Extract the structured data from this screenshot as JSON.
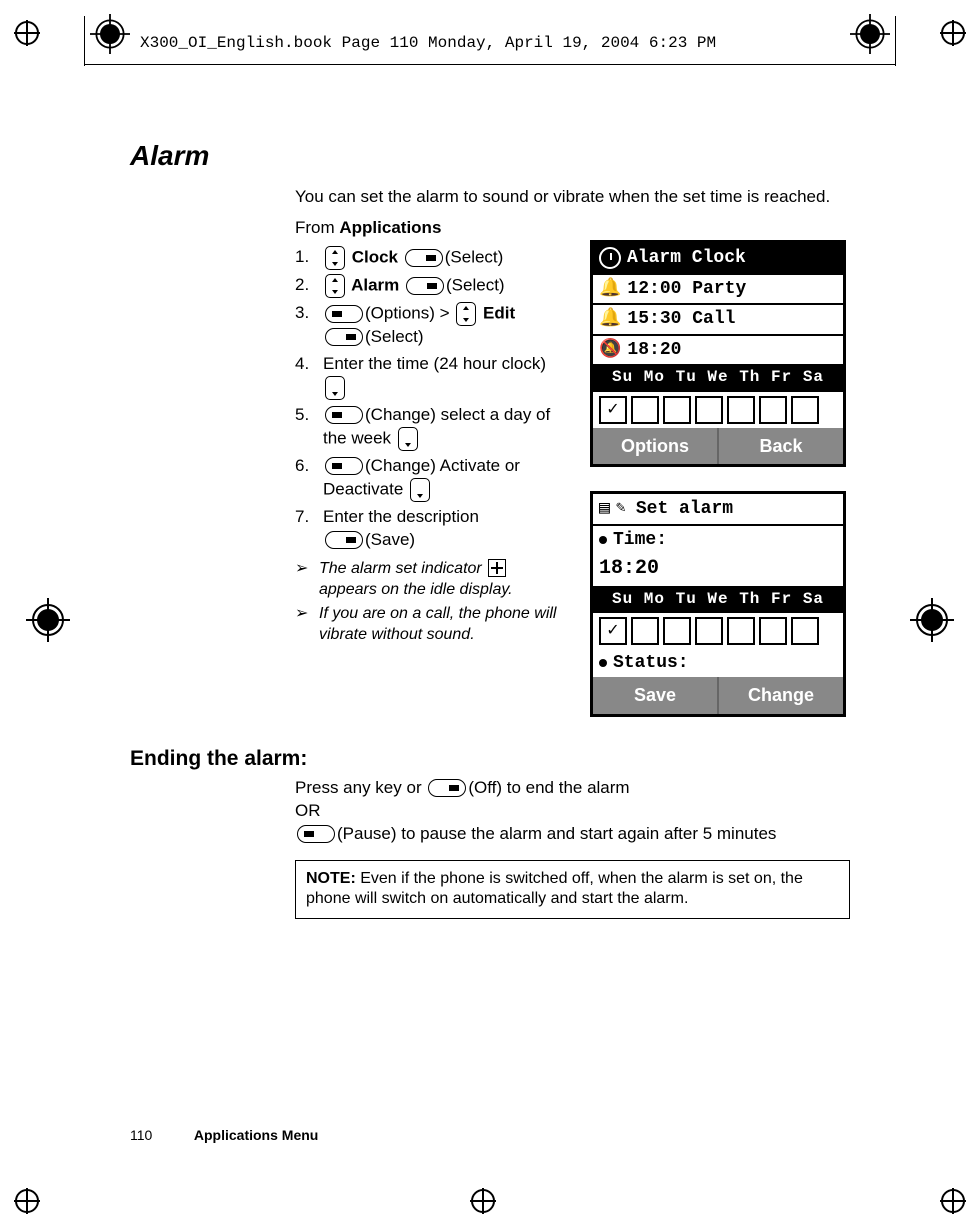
{
  "header": {
    "file_stamp": "X300_OI_English.book  Page 110  Monday, April 19, 2004  6:23 PM"
  },
  "section": {
    "title": "Alarm"
  },
  "intro": "You can set the alarm to sound or vibrate when the set time is reached.",
  "from": "From ",
  "from_bold": "Applications",
  "steps": [
    {
      "n": "1.",
      "before": "",
      "key1": "nav",
      "bold": " Clock ",
      "key2": "sk-right",
      "after": "(Select)"
    },
    {
      "n": "2.",
      "before": "",
      "key1": "nav",
      "bold": " Alarm ",
      "key2": "sk-right",
      "after": "(Select)"
    },
    {
      "n": "3.",
      "before": "",
      "key1": "sk-left",
      "mid": "(Options) > ",
      "key2": "nav",
      "bold": " Edit",
      "key3": "sk-right",
      "after2": "(Select)"
    },
    {
      "n": "4.",
      "text": "Enter the time (24 hour clock) ",
      "key_end": "nav-down"
    },
    {
      "n": "5.",
      "before": "",
      "key1": "sk-left",
      "mid": "(Change) select a day of the week ",
      "key_end": "nav-down"
    },
    {
      "n": "6.",
      "before": "",
      "key1": "sk-left",
      "mid": "(Change) Activate or Deactivate ",
      "key_end": "nav-down"
    },
    {
      "n": "7.",
      "text": "Enter the description ",
      "key1": "sk-right",
      "after": "(Save)"
    }
  ],
  "notes_arrow": [
    "The alarm set indicator      appears on the idle display.",
    "If you are on a call, the phone will vibrate without sound."
  ],
  "phone1": {
    "title": "Alarm Clock",
    "rows": [
      {
        "icon": "bell",
        "text": "12:00 Party"
      },
      {
        "icon": "bell",
        "text": "15:30 Call"
      },
      {
        "icon": "bell-off",
        "text": "18:20"
      }
    ],
    "days": "Su Mo Tu We Th Fr Sa",
    "soft_left": "Options",
    "soft_right": "Back"
  },
  "phone2": {
    "title": "Set alarm",
    "field_time": "Time:",
    "time_value": "18:20",
    "days": "Su Mo Tu We Th Fr Sa",
    "field_status": "Status:",
    "soft_left": "Save",
    "soft_right": "Change"
  },
  "ending": {
    "heading": "Ending the alarm:",
    "line1_a": "Press any key or ",
    "line1_b": "(Off) to end the alarm",
    "or": "OR",
    "line2": "(Pause) to pause the alarm and start again after 5 minutes"
  },
  "note_box": {
    "label": "NOTE:",
    "text": " Even if the phone is switched off, when the alarm is set on, the phone will switch on automatically and start the alarm."
  },
  "footer": {
    "page": "110",
    "section": "Applications Menu"
  }
}
